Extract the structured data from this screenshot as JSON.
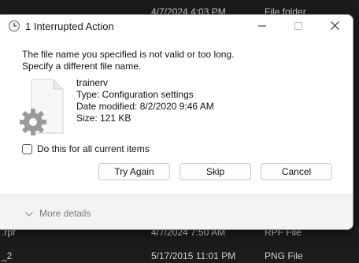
{
  "background": {
    "top_row": {
      "date": "4/7/2024 4:03 PM",
      "type": "File folder"
    },
    "rows": [
      {
        "name": ".rpf",
        "date": "4/7/2024 7:50 AM",
        "type": "RPF File"
      },
      {
        "name": "_2",
        "date": "5/17/2015 11:01 PM",
        "type": "PNG File"
      }
    ]
  },
  "dialog": {
    "title": "1 Interrupted Action",
    "message_line1": "The file name you specified is not valid or too long.",
    "message_line2": "Specify a different file name.",
    "file": {
      "name": "trainerv",
      "type": "Type: Configuration settings",
      "date_modified": "Date modified: 8/2/2020 9:46 AM",
      "size": "Size: 121 KB"
    },
    "checkbox_label": "Do this for all current items",
    "checkbox_checked": false,
    "buttons": {
      "try_again": "Try Again",
      "skip": "Skip",
      "cancel": "Cancel"
    },
    "more_details": "More details"
  },
  "icons": {
    "title": "copy-progress-icon",
    "minimize": "minimize-icon",
    "maximize": "maximize-icon",
    "close": "close-icon",
    "file": "config-file-icon",
    "chevron": "chevron-down-icon"
  }
}
